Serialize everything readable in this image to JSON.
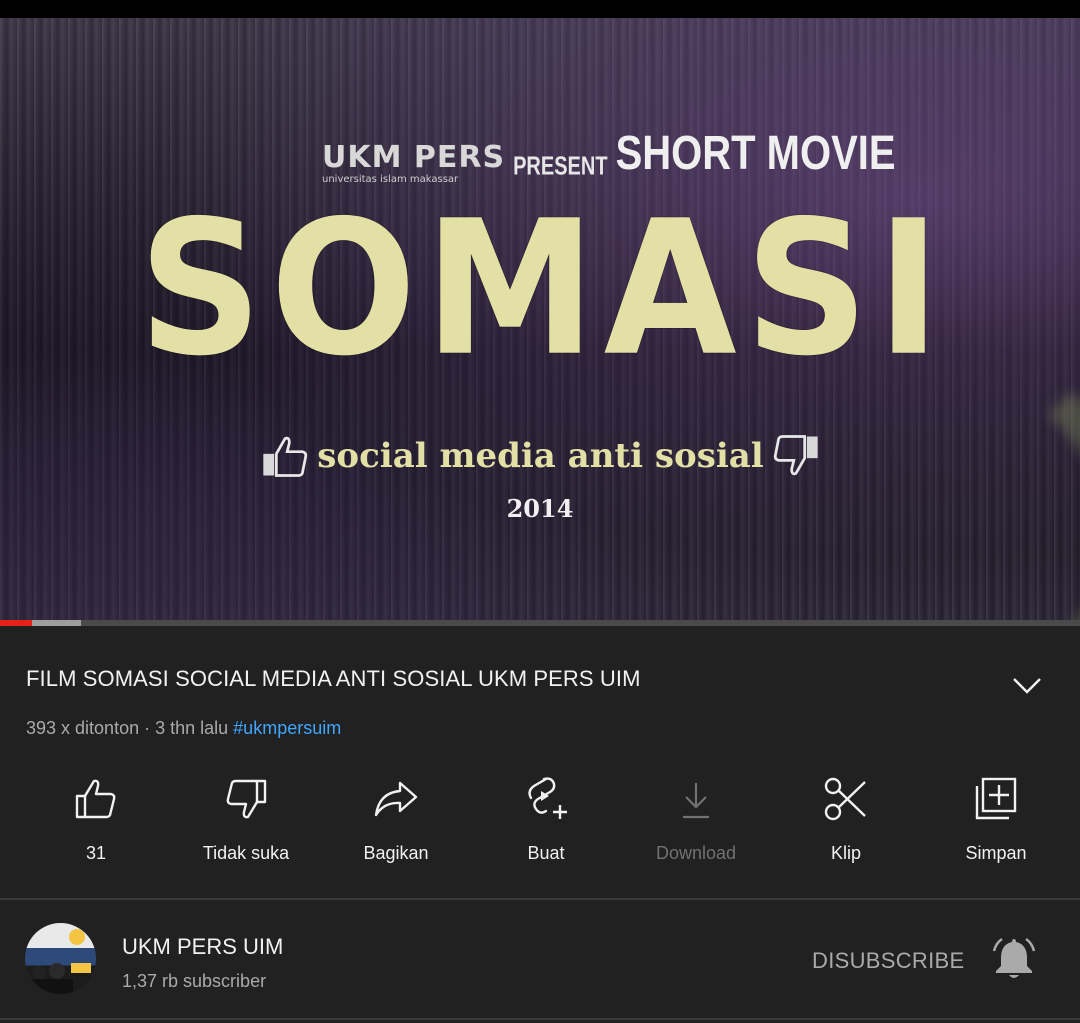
{
  "video": {
    "brand": "UKM PERS",
    "brand_sub": "universitas islam makassar",
    "present": "PRESENT",
    "short_movie": "SHORT MOVIE",
    "big_title": "SOMASI",
    "tagline": "social media anti sosial",
    "year": "2014",
    "progress_played_fraction": 0.03,
    "progress_buffered_fraction": 0.075
  },
  "info": {
    "title": "FILM SOMASI SOCIAL MEDIA ANTI SOSIAL UKM PERS UIM",
    "views": "393 x ditonton",
    "separator": " · ",
    "age": "3 thn lalu",
    "hashtag": "#ukmpersuim"
  },
  "actions": [
    {
      "label": "31",
      "icon": "thumb-up-icon"
    },
    {
      "label": "Tidak suka",
      "icon": "thumb-down-icon"
    },
    {
      "label": "Bagikan",
      "icon": "share-icon"
    },
    {
      "label": "Buat",
      "icon": "create-icon"
    },
    {
      "label": "Download",
      "icon": "download-icon"
    },
    {
      "label": "Klip",
      "icon": "scissors-icon"
    },
    {
      "label": "Simpan",
      "icon": "save-playlist-icon"
    }
  ],
  "channel": {
    "name": "UKM PERS UIM",
    "subscribers": "1,37 rb subscriber",
    "unsubscribe_label": "DISUBSCRIBE"
  },
  "colors": {
    "background": "#212121",
    "accent_red": "#e62117",
    "link_blue": "#3ea6ff",
    "secondary_text": "#aaaaaa",
    "title_yellow": "#e3e0a6"
  }
}
